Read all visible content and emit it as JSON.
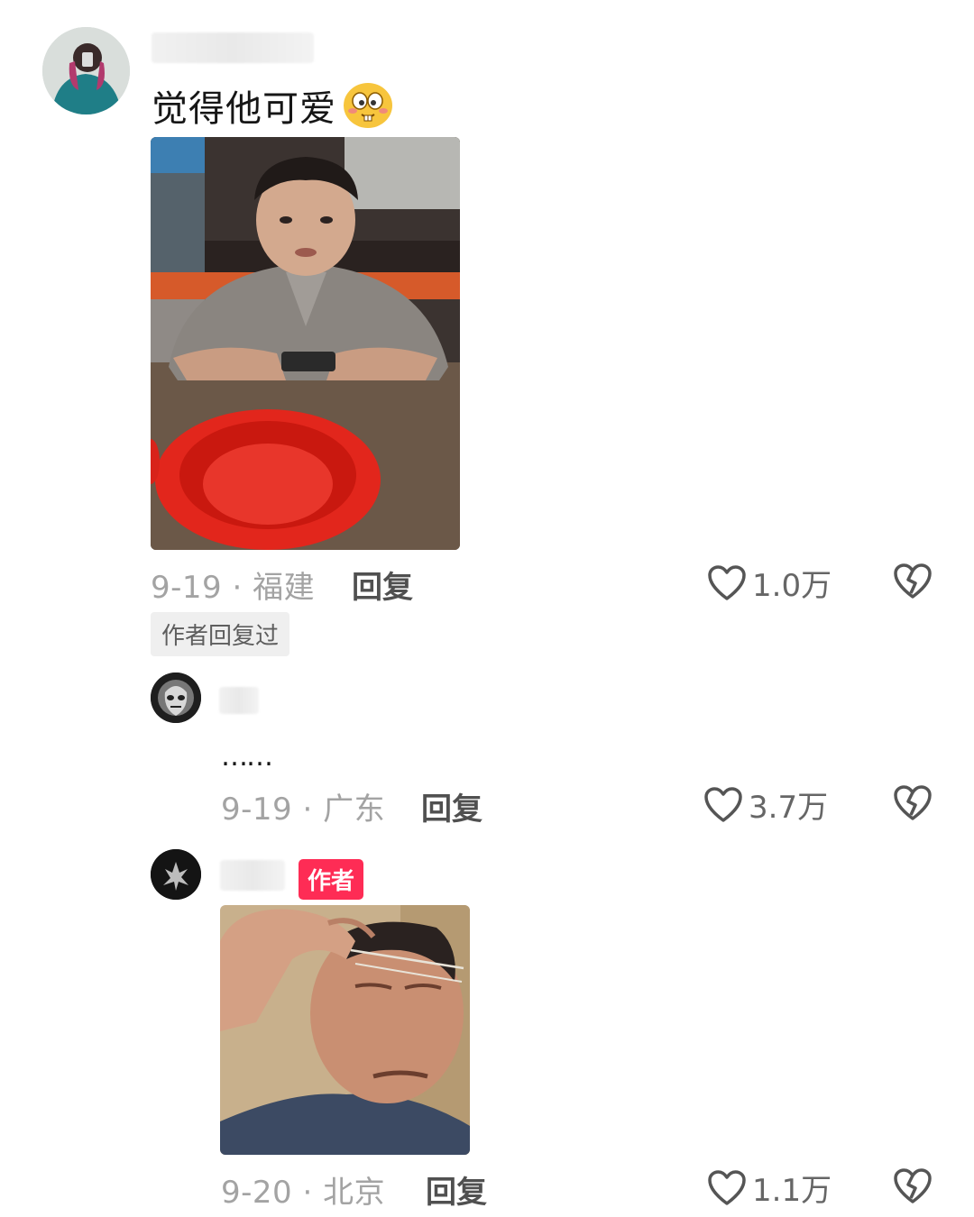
{
  "comments": [
    {
      "id": "c1",
      "text": "觉得他可爱",
      "emoji": "goofy-face-emoji",
      "date_location": "9-19 · 福建",
      "reply_label": "回复",
      "likes": "1.0万",
      "tag": "作者回复过"
    },
    {
      "id": "c2",
      "text": "……",
      "date_location": "9-19 · 广东",
      "reply_label": "回复",
      "likes": "3.7万"
    },
    {
      "id": "c3",
      "badge": "作者",
      "date_location": "9-20 · 北京",
      "reply_label": "回复",
      "likes": "1.1万"
    }
  ],
  "icons": {
    "like": "heart-outline-icon",
    "dislike": "broken-heart-icon"
  },
  "colors": {
    "author_badge": "#fe2c55",
    "meta_text": "#a3a3a3",
    "background": "#ffffff"
  }
}
